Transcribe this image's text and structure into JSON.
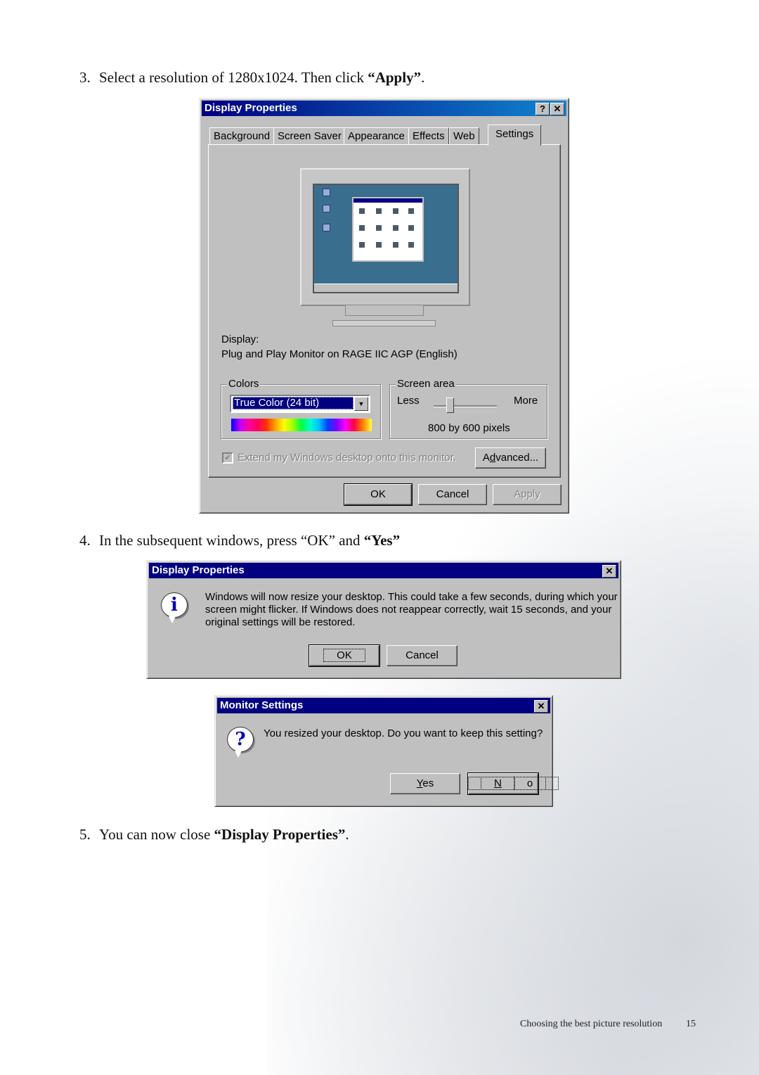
{
  "steps": [
    {
      "num": "3.",
      "text": "Select a resolution of 1280x1024. Then click ",
      "emph": "“Apply”",
      "tail": "."
    },
    {
      "num": "4.",
      "text": "In the subsequent windows, press “OK” and ",
      "emph": "“Yes”",
      "tail": ""
    },
    {
      "num": "5.",
      "text": "You can now close ",
      "emph": "“Display Properties”",
      "tail": "."
    }
  ],
  "display_properties": {
    "title": "Display Properties",
    "help_icon": "?",
    "close_icon": "✕",
    "tabs": [
      "Background",
      "Screen Saver",
      "Appearance",
      "Effects",
      "Web",
      "Settings"
    ],
    "active_tab": "Settings",
    "display_label": "Display:",
    "display_value": "Plug and Play Monitor on RAGE IIC AGP (English)",
    "colors": {
      "group_label": "Colors",
      "selected": "True Color (24 bit)",
      "arrow": "▼"
    },
    "screen_area": {
      "group_label": "Screen area",
      "less": "Less",
      "more": "More",
      "resolution": "800 by 600 pixels",
      "slider_position": 0.25
    },
    "extend_checkbox": {
      "label": "Extend my Windows desktop onto this monitor.",
      "checked": true,
      "check_glyph": "✔",
      "disabled": true
    },
    "advanced_button": {
      "pre": "A",
      "ul": "d",
      "post": "vanced..."
    },
    "ok_button": "OK",
    "cancel_button": "Cancel",
    "apply_button": "Apply"
  },
  "resize_dialog": {
    "title": "Display Properties",
    "close_icon": "✕",
    "icon": "i",
    "message_lines": [
      "Windows will now resize your desktop. This could take a few seconds, during which your",
      "screen might flicker.  If Windows does not reappear correctly, wait 15 seconds, and your",
      "original settings will be restored."
    ],
    "ok_button": "OK",
    "cancel_button": "Cancel"
  },
  "monitor_settings": {
    "title": "Monitor Settings",
    "close_icon": "✕",
    "icon": "?",
    "message": "You resized your desktop.  Do you want to keep this setting?",
    "yes_button": {
      "ul": "Y",
      "post": "es"
    },
    "no_button": {
      "ul": "N",
      "post": "o"
    }
  },
  "footer": {
    "section": "Choosing the best picture resolution",
    "page": "15"
  }
}
